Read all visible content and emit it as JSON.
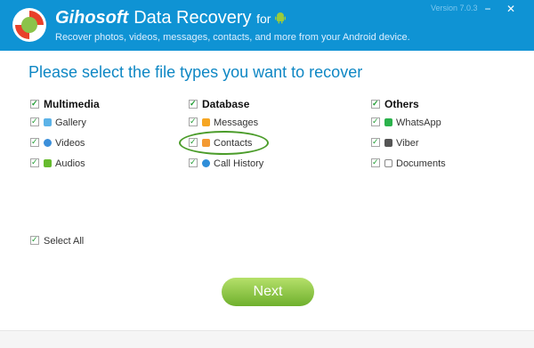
{
  "header": {
    "brand": "Gihosoft",
    "product": "Data Recovery",
    "for_text": "for",
    "subtitle": "Recover photos, videos, messages, contacts, and more from your Android device.",
    "version": "Version 7.0.3",
    "minimize_icon": "−",
    "close_icon": "✕"
  },
  "main": {
    "heading": "Please select the file types you want to recover",
    "groups": [
      {
        "title": "Multimedia",
        "items": [
          {
            "label": "Gallery",
            "icon": "gallery-icon"
          },
          {
            "label": "Videos",
            "icon": "videos-icon"
          },
          {
            "label": "Audios",
            "icon": "audios-icon"
          }
        ]
      },
      {
        "title": "Database",
        "items": [
          {
            "label": "Messages",
            "icon": "messages-icon"
          },
          {
            "label": "Contacts",
            "icon": "contacts-icon"
          },
          {
            "label": "Call History",
            "icon": "call-history-icon"
          }
        ]
      },
      {
        "title": "Others",
        "items": [
          {
            "label": "WhatsApp",
            "icon": "whatsapp-icon"
          },
          {
            "label": "Viber",
            "icon": "viber-icon"
          },
          {
            "label": "Documents",
            "icon": "documents-icon"
          }
        ]
      }
    ],
    "select_all": "Select All",
    "next": "Next"
  },
  "colors": {
    "header_bg": "#0f93d4",
    "accent": "#0e87c4",
    "next_button": "#6fb02d",
    "highlight": "#4b9c2a"
  }
}
